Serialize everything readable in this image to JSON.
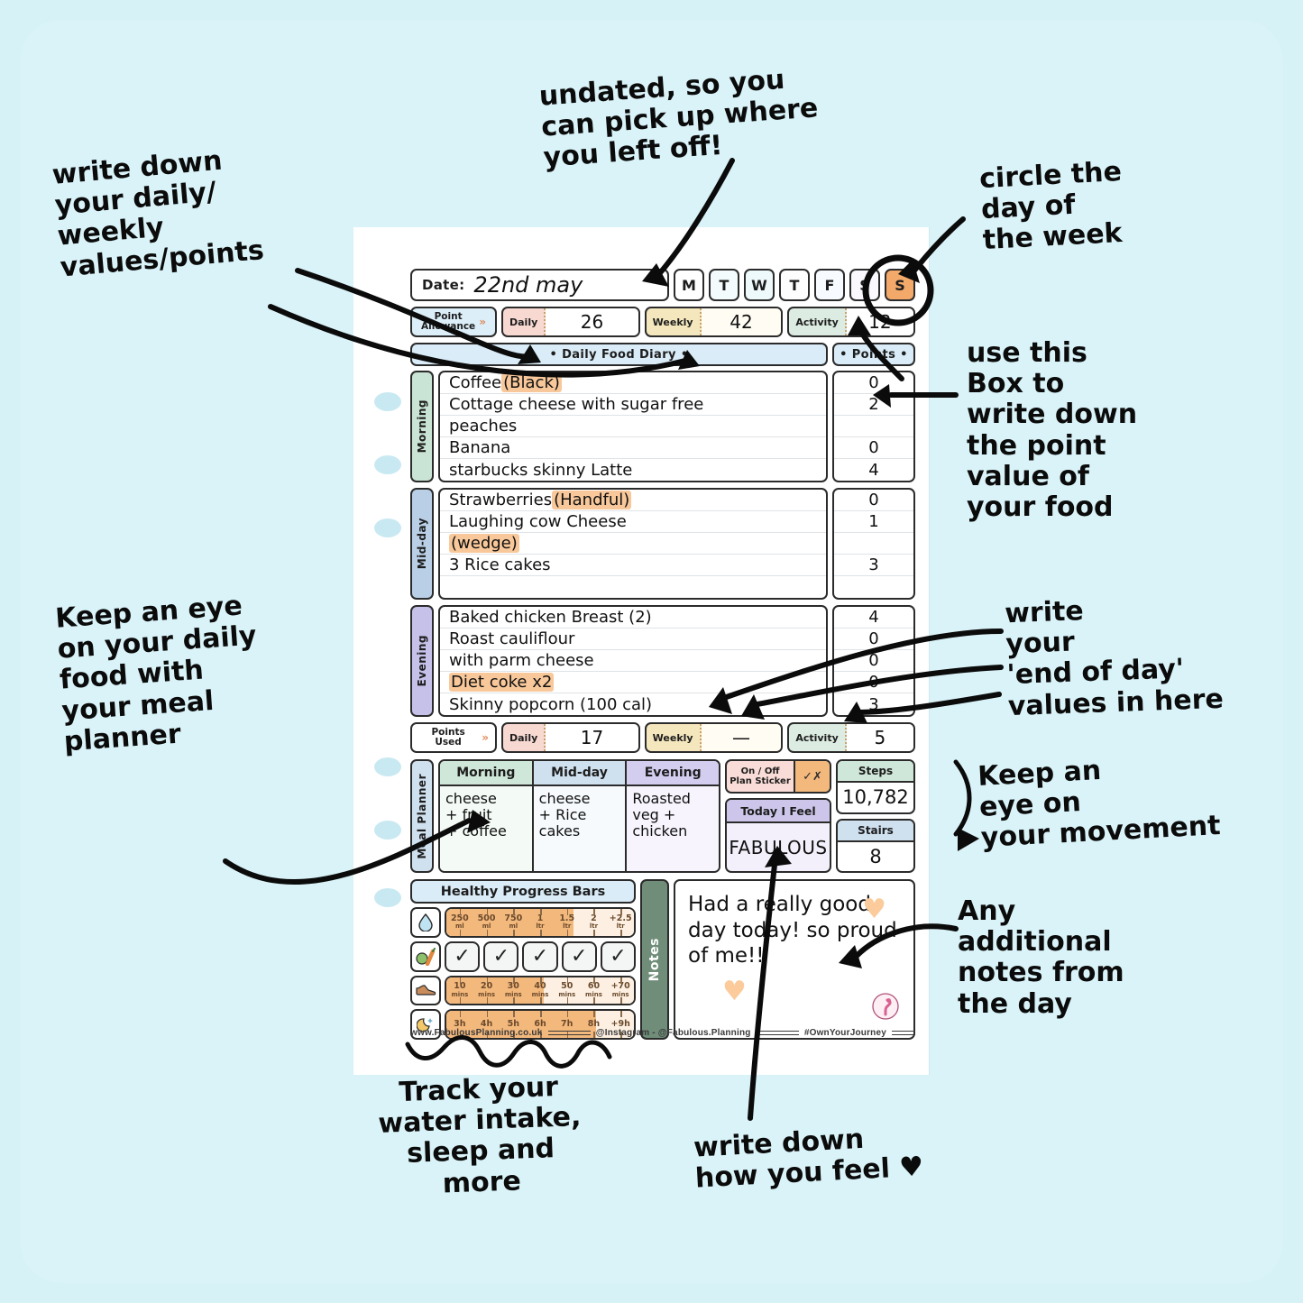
{
  "planner": {
    "date": {
      "label": "Date:",
      "value": "22nd may"
    },
    "days": [
      {
        "letter": "M",
        "selected": false
      },
      {
        "letter": "T",
        "selected": false
      },
      {
        "letter": "W",
        "selected": false
      },
      {
        "letter": "T",
        "selected": false
      },
      {
        "letter": "F",
        "selected": false
      },
      {
        "letter": "S",
        "selected": false
      },
      {
        "letter": "S",
        "selected": true
      }
    ],
    "point_allowance": {
      "label": "Point\nAllowance",
      "chevron": "»",
      "fields": [
        {
          "caption": "Daily",
          "value": "26"
        },
        {
          "caption": "Weekly",
          "value": "42"
        },
        {
          "caption": "Activity",
          "value": "12"
        }
      ]
    },
    "diary_header": {
      "title": "• Daily Food Diary •",
      "points": "• Points •"
    },
    "meals": [
      {
        "tab": "Morning",
        "lines": [
          {
            "text": "Coffee ",
            "highlight": "(Black)"
          },
          {
            "text": "Cottage cheese with sugar free",
            "highlight": ""
          },
          {
            "text": "peaches",
            "highlight": ""
          },
          {
            "text": " Banana",
            "highlight": ""
          },
          {
            "text": "starbucks skinny Latte",
            "highlight": ""
          }
        ],
        "points": [
          "0",
          "2",
          "",
          "0",
          "4"
        ]
      },
      {
        "tab": "Mid-day",
        "lines": [
          {
            "text": "Strawberries ",
            "highlight": "(Handful)"
          },
          {
            "text": "Laughing cow Cheese",
            "highlight": ""
          },
          {
            "text": "",
            "highlight": "(wedge)"
          },
          {
            "text": "3 Rice cakes",
            "highlight": ""
          },
          {
            "text": "",
            "highlight": ""
          }
        ],
        "points": [
          "0",
          "1",
          "",
          "3",
          ""
        ]
      },
      {
        "tab": "Evening",
        "lines": [
          {
            "text": "Baked chicken Breast (2)",
            "highlight": ""
          },
          {
            "text": "Roast cauliflour",
            "highlight": ""
          },
          {
            "text": "with parm cheese",
            "highlight": ""
          },
          {
            "text": "",
            "highlight": "Diet coke x2"
          },
          {
            "text": " Skinny  popcorn (100 cal)",
            "highlight": ""
          }
        ],
        "points": [
          "4",
          "0",
          "0",
          "0",
          "3"
        ]
      }
    ],
    "points_used": {
      "label": "Points Used",
      "chevron": "»",
      "fields": [
        {
          "caption": "Daily",
          "value": "17"
        },
        {
          "caption": "Weekly",
          "value": "—"
        },
        {
          "caption": "Activity",
          "value": "5"
        }
      ]
    },
    "meal_planner": {
      "tab": "Meal Planner",
      "columns": [
        {
          "header": "Morning",
          "body": "cheese\n+ fruit\n+ coffee"
        },
        {
          "header": "Mid-day",
          "body": "cheese\n+ Rice\ncakes"
        },
        {
          "header": "Evening",
          "body": "Roasted\nveg +\nchicken"
        }
      ]
    },
    "sticker": {
      "label": "On / Off\nPlan Sticker",
      "marks": "✓✗"
    },
    "today_i_feel": {
      "label": "Today I Feel",
      "value": "FABULOUS"
    },
    "metrics": [
      {
        "label": "Steps",
        "value": "10,782"
      },
      {
        "label": "Stairs",
        "value": "8"
      }
    ],
    "healthy_progress": {
      "title": "Healthy Progress Bars",
      "water": {
        "icon": "water-drop-icon",
        "ticks": [
          {
            "top": "250",
            "bottom": "ml"
          },
          {
            "top": "500",
            "bottom": "ml"
          },
          {
            "top": "750",
            "bottom": "ml"
          },
          {
            "top": "1",
            "bottom": "ltr"
          },
          {
            "top": "1.5",
            "bottom": "ltr"
          },
          {
            "top": "2",
            "bottom": "ltr"
          },
          {
            "top": "+2.5",
            "bottom": "ltr"
          }
        ],
        "filled_percent": 68
      },
      "fruitveg": {
        "icon": "fruit-veg-icon",
        "checks": [
          "✓",
          "✓",
          "✓",
          "✓",
          "✓"
        ]
      },
      "exercise": {
        "icon": "trainer-shoe-icon",
        "ticks": [
          {
            "top": "10",
            "bottom": "mins"
          },
          {
            "top": "20",
            "bottom": "mins"
          },
          {
            "top": "30",
            "bottom": "mins"
          },
          {
            "top": "40",
            "bottom": "mins"
          },
          {
            "top": "50",
            "bottom": "mins"
          },
          {
            "top": "60",
            "bottom": "mins"
          },
          {
            "top": "+70",
            "bottom": "mins"
          }
        ],
        "filled_percent": 52
      },
      "sleep": {
        "icon": "moon-stars-icon",
        "ticks": [
          {
            "top": "3h",
            "bottom": ""
          },
          {
            "top": "4h",
            "bottom": ""
          },
          {
            "top": "5h",
            "bottom": ""
          },
          {
            "top": "6h",
            "bottom": ""
          },
          {
            "top": "7h",
            "bottom": ""
          },
          {
            "top": "8h",
            "bottom": ""
          },
          {
            "top": "+9h",
            "bottom": ""
          }
        ],
        "filled_percent": 80
      }
    },
    "notes": {
      "tab": "Notes",
      "text": "Had a really\ngood day\ntoday! so proud\n    of me!!"
    },
    "footer": {
      "website": "www.FabulousPlanning.co.uk",
      "instagram": "@Instagram - @Fabulous.Planning",
      "hashtag": "#OwnYourJourney"
    }
  },
  "annotations": {
    "write_values": "write down\nyour daily/\nweekly\nvalues/points",
    "undated": "undated, so you\ncan pick up where\nyou left off!",
    "circle_day": "circle the\nday of\nthe week",
    "use_box": "use this\nBox to\nwrite down\nthe point\nvalue of\nyour food",
    "keep_eye_food": "Keep an eye\non your daily\nfood with\nyour meal\nplanner",
    "write_end_of_day": "write\nyour\n'end of day'\nvalues in here",
    "keep_eye_movement": "Keep an\neye on\nyour movement",
    "any_notes": "Any\nadditional\nnotes from\nthe day",
    "track_water": "Track your\nwater intake,\nsleep and\nmore",
    "write_feel": "write down\nhow you feel ♥"
  }
}
